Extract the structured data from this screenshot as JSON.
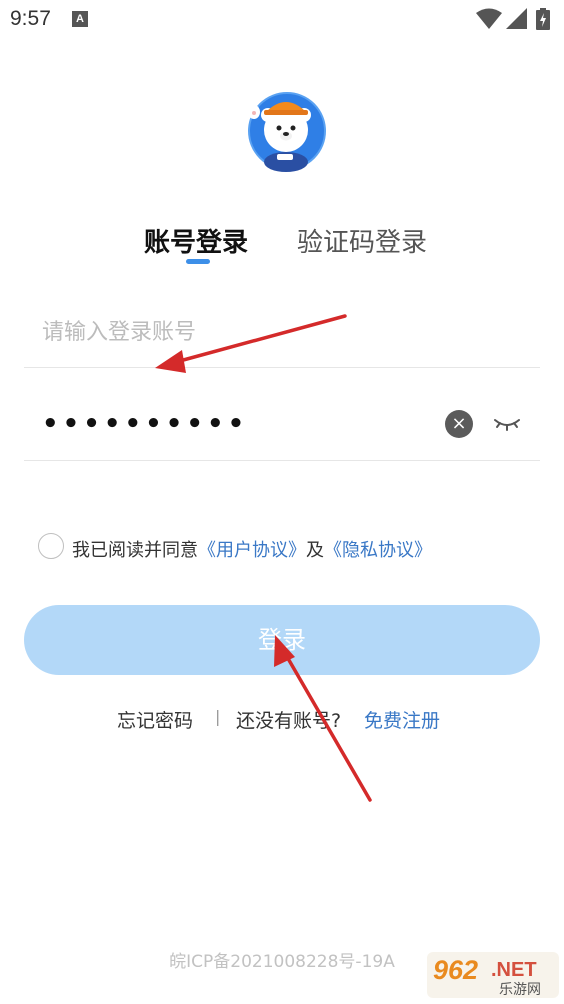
{
  "status_bar": {
    "time": "9:57",
    "notification_letter": "A"
  },
  "tabs": {
    "account_login": "账号登录",
    "code_login": "验证码登录"
  },
  "account_field": {
    "placeholder": "请输入登录账号",
    "value": ""
  },
  "password_field": {
    "masked_value": "••••••••••"
  },
  "agreement": {
    "prefix": "我已阅读并同意",
    "user_agreement": "《用户协议》",
    "and": "及",
    "privacy_policy": "《隐私协议》",
    "checked": false
  },
  "login_button": {
    "label": "登录"
  },
  "links": {
    "forgot_password": "忘记密码",
    "separator": "|",
    "no_account": "还没有账号?",
    "register": "免费注册"
  },
  "footer": {
    "icp": "皖ICP备2021008228号-19A"
  },
  "watermark": {
    "number": "962",
    "domain": ".NET",
    "subtitle": "乐游网"
  },
  "colors": {
    "accent": "#3d8fe8",
    "link": "#3a78c6",
    "button_disabled": "#b3d8f8",
    "arrow": "#d42a2a"
  }
}
